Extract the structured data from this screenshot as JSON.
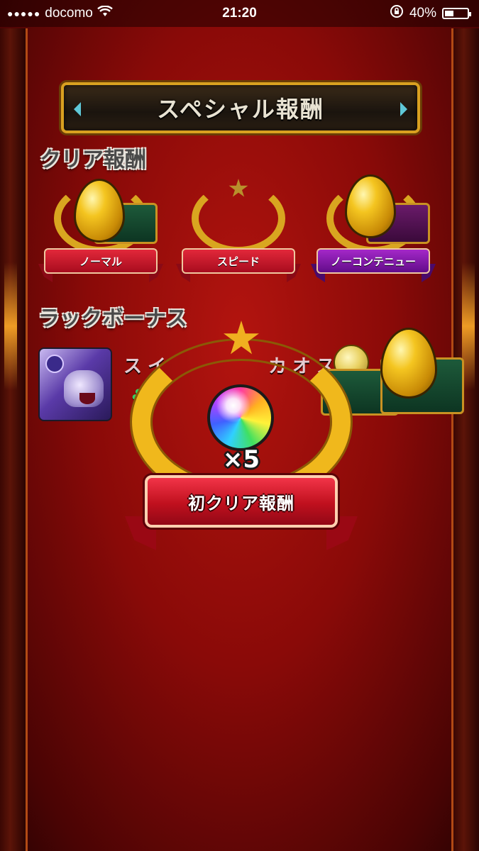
{
  "status_bar": {
    "signal": "●●●●●",
    "carrier": "docomo",
    "time": "21:20",
    "battery_percent": "40%",
    "battery_level": 0.4
  },
  "header": {
    "title": "スペシャル報酬"
  },
  "clear_rewards": {
    "label": "クリア報酬",
    "badges": [
      {
        "label": "ノーマル",
        "ribbon_color": "#c8102a",
        "has_egg": true
      },
      {
        "label": "スピード",
        "ribbon_color": "#c8102a",
        "has_egg": false
      },
      {
        "label": "ノーコンテニュー",
        "ribbon_color": "#8a1ab0",
        "has_egg": true
      }
    ]
  },
  "luck_bonus": {
    "label": "ラックボーナス",
    "monster_name": "スイ　　　　カオス",
    "clover": "♣"
  },
  "first_clear_award": {
    "count": "×5",
    "label": "初クリア報酬"
  },
  "colors": {
    "background": "#8a0a08",
    "gold": "#f0b81c",
    "ribbon_red": "#c0101e",
    "ribbon_purple": "#620c8a"
  }
}
